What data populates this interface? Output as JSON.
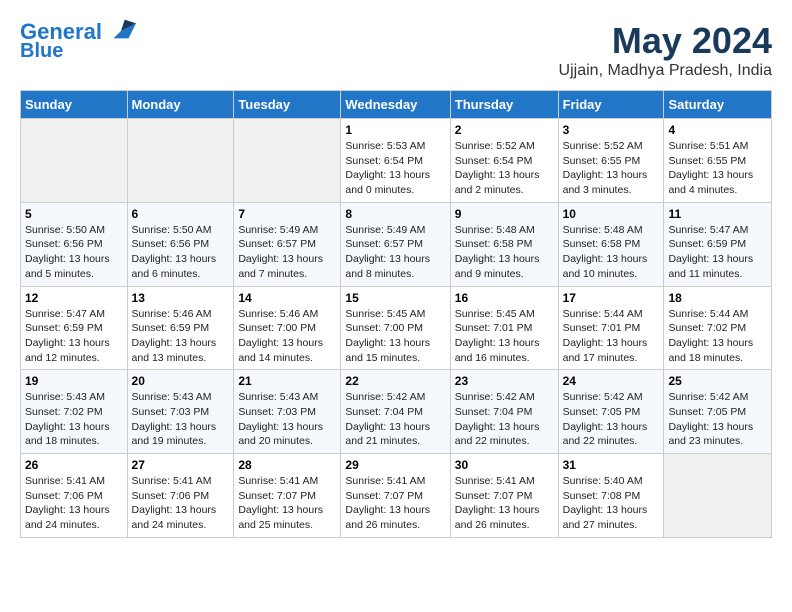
{
  "header": {
    "logo_line1": "General",
    "logo_line2": "Blue",
    "month": "May 2024",
    "location": "Ujjain, Madhya Pradesh, India"
  },
  "weekdays": [
    "Sunday",
    "Monday",
    "Tuesday",
    "Wednesday",
    "Thursday",
    "Friday",
    "Saturday"
  ],
  "weeks": [
    [
      {
        "day": "",
        "info": ""
      },
      {
        "day": "",
        "info": ""
      },
      {
        "day": "",
        "info": ""
      },
      {
        "day": "1",
        "info": "Sunrise: 5:53 AM\nSunset: 6:54 PM\nDaylight: 13 hours\nand 0 minutes."
      },
      {
        "day": "2",
        "info": "Sunrise: 5:52 AM\nSunset: 6:54 PM\nDaylight: 13 hours\nand 2 minutes."
      },
      {
        "day": "3",
        "info": "Sunrise: 5:52 AM\nSunset: 6:55 PM\nDaylight: 13 hours\nand 3 minutes."
      },
      {
        "day": "4",
        "info": "Sunrise: 5:51 AM\nSunset: 6:55 PM\nDaylight: 13 hours\nand 4 minutes."
      }
    ],
    [
      {
        "day": "5",
        "info": "Sunrise: 5:50 AM\nSunset: 6:56 PM\nDaylight: 13 hours\nand 5 minutes."
      },
      {
        "day": "6",
        "info": "Sunrise: 5:50 AM\nSunset: 6:56 PM\nDaylight: 13 hours\nand 6 minutes."
      },
      {
        "day": "7",
        "info": "Sunrise: 5:49 AM\nSunset: 6:57 PM\nDaylight: 13 hours\nand 7 minutes."
      },
      {
        "day": "8",
        "info": "Sunrise: 5:49 AM\nSunset: 6:57 PM\nDaylight: 13 hours\nand 8 minutes."
      },
      {
        "day": "9",
        "info": "Sunrise: 5:48 AM\nSunset: 6:58 PM\nDaylight: 13 hours\nand 9 minutes."
      },
      {
        "day": "10",
        "info": "Sunrise: 5:48 AM\nSunset: 6:58 PM\nDaylight: 13 hours\nand 10 minutes."
      },
      {
        "day": "11",
        "info": "Sunrise: 5:47 AM\nSunset: 6:59 PM\nDaylight: 13 hours\nand 11 minutes."
      }
    ],
    [
      {
        "day": "12",
        "info": "Sunrise: 5:47 AM\nSunset: 6:59 PM\nDaylight: 13 hours\nand 12 minutes."
      },
      {
        "day": "13",
        "info": "Sunrise: 5:46 AM\nSunset: 6:59 PM\nDaylight: 13 hours\nand 13 minutes."
      },
      {
        "day": "14",
        "info": "Sunrise: 5:46 AM\nSunset: 7:00 PM\nDaylight: 13 hours\nand 14 minutes."
      },
      {
        "day": "15",
        "info": "Sunrise: 5:45 AM\nSunset: 7:00 PM\nDaylight: 13 hours\nand 15 minutes."
      },
      {
        "day": "16",
        "info": "Sunrise: 5:45 AM\nSunset: 7:01 PM\nDaylight: 13 hours\nand 16 minutes."
      },
      {
        "day": "17",
        "info": "Sunrise: 5:44 AM\nSunset: 7:01 PM\nDaylight: 13 hours\nand 17 minutes."
      },
      {
        "day": "18",
        "info": "Sunrise: 5:44 AM\nSunset: 7:02 PM\nDaylight: 13 hours\nand 18 minutes."
      }
    ],
    [
      {
        "day": "19",
        "info": "Sunrise: 5:43 AM\nSunset: 7:02 PM\nDaylight: 13 hours\nand 18 minutes."
      },
      {
        "day": "20",
        "info": "Sunrise: 5:43 AM\nSunset: 7:03 PM\nDaylight: 13 hours\nand 19 minutes."
      },
      {
        "day": "21",
        "info": "Sunrise: 5:43 AM\nSunset: 7:03 PM\nDaylight: 13 hours\nand 20 minutes."
      },
      {
        "day": "22",
        "info": "Sunrise: 5:42 AM\nSunset: 7:04 PM\nDaylight: 13 hours\nand 21 minutes."
      },
      {
        "day": "23",
        "info": "Sunrise: 5:42 AM\nSunset: 7:04 PM\nDaylight: 13 hours\nand 22 minutes."
      },
      {
        "day": "24",
        "info": "Sunrise: 5:42 AM\nSunset: 7:05 PM\nDaylight: 13 hours\nand 22 minutes."
      },
      {
        "day": "25",
        "info": "Sunrise: 5:42 AM\nSunset: 7:05 PM\nDaylight: 13 hours\nand 23 minutes."
      }
    ],
    [
      {
        "day": "26",
        "info": "Sunrise: 5:41 AM\nSunset: 7:06 PM\nDaylight: 13 hours\nand 24 minutes."
      },
      {
        "day": "27",
        "info": "Sunrise: 5:41 AM\nSunset: 7:06 PM\nDaylight: 13 hours\nand 24 minutes."
      },
      {
        "day": "28",
        "info": "Sunrise: 5:41 AM\nSunset: 7:07 PM\nDaylight: 13 hours\nand 25 minutes."
      },
      {
        "day": "29",
        "info": "Sunrise: 5:41 AM\nSunset: 7:07 PM\nDaylight: 13 hours\nand 26 minutes."
      },
      {
        "day": "30",
        "info": "Sunrise: 5:41 AM\nSunset: 7:07 PM\nDaylight: 13 hours\nand 26 minutes."
      },
      {
        "day": "31",
        "info": "Sunrise: 5:40 AM\nSunset: 7:08 PM\nDaylight: 13 hours\nand 27 minutes."
      },
      {
        "day": "",
        "info": ""
      }
    ]
  ]
}
